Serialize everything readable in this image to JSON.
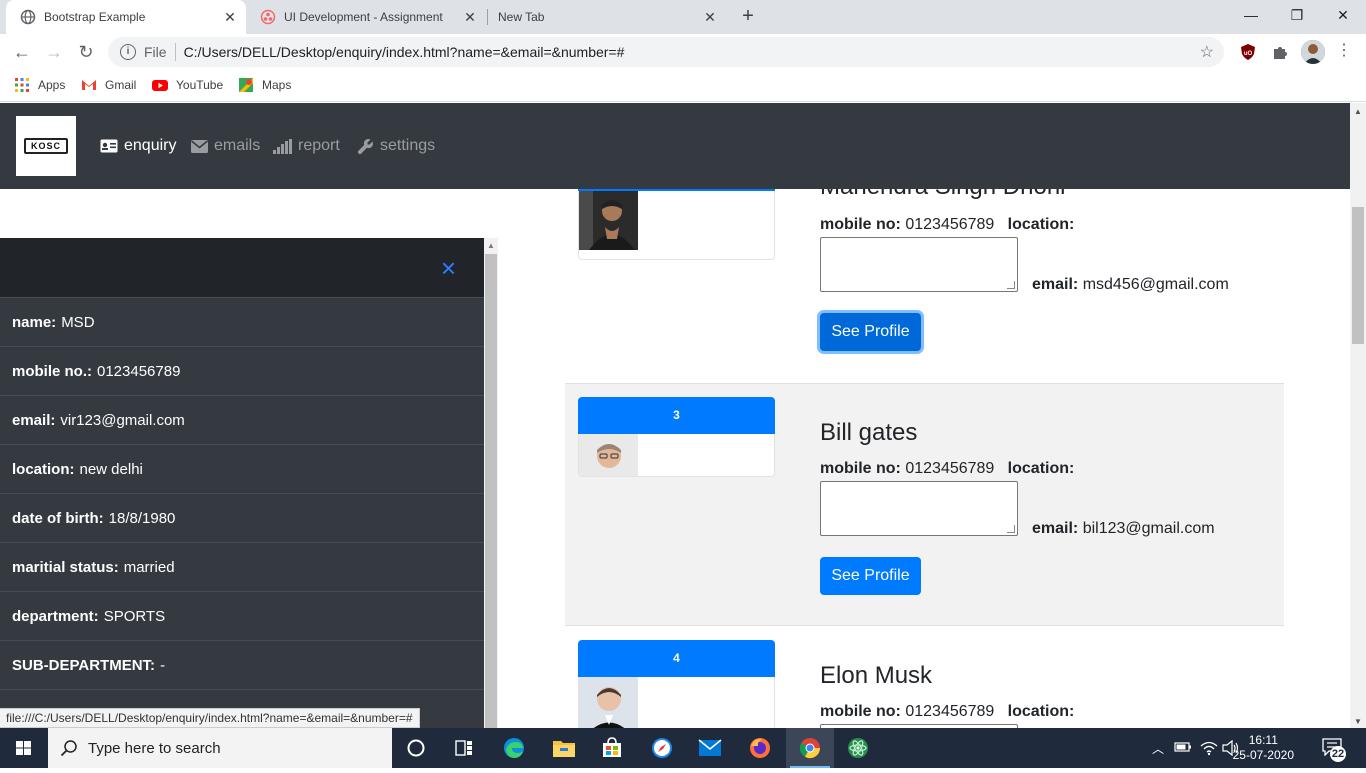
{
  "browser": {
    "tabs": [
      {
        "label": "Bootstrap Example",
        "icon": "globe-icon"
      },
      {
        "label": "UI Development - Assignment",
        "icon": "asana-icon"
      },
      {
        "label": "New Tab",
        "icon": ""
      }
    ],
    "url_prefix": "File",
    "url": "C:/Users/DELL/Desktop/enquiry/index.html?name=&email=&number=#",
    "bookmarks": [
      {
        "label": "Apps",
        "icon": "apps-grid-icon"
      },
      {
        "label": "Gmail",
        "icon": "gmail-icon"
      },
      {
        "label": "YouTube",
        "icon": "youtube-icon"
      },
      {
        "label": "Maps",
        "icon": "maps-icon"
      }
    ],
    "status_url": "file:///C:/Users/DELL/Desktop/enquiry/index.html?name=&email=&number=#"
  },
  "navbar": {
    "logo_text": "KOSC",
    "links": [
      {
        "label": "enquiry",
        "icon": "id-card-icon"
      },
      {
        "label": "emails",
        "icon": "envelope-icon"
      },
      {
        "label": "report",
        "icon": "signal-bars-icon"
      },
      {
        "label": "settings",
        "icon": "wrench-icon"
      }
    ]
  },
  "sidebar": {
    "close_symbol": "×",
    "rows": [
      {
        "label": "name:",
        "value": " MSD"
      },
      {
        "label": "mobile no.:",
        "value": "0123456789"
      },
      {
        "label": "email:",
        "value": "vir123@gmail.com"
      },
      {
        "label": "location:",
        "value": " new delhi"
      },
      {
        "label": "date of birth:",
        "value": "18/8/1980"
      },
      {
        "label": "maritial status:",
        "value": "married"
      },
      {
        "label": "department:",
        "value": "SPORTS"
      },
      {
        "label": "SUB-DEPARTMENT:",
        "value": "-"
      }
    ]
  },
  "cards": [
    {
      "number": "",
      "name": "Mahendra Singh Dhoni",
      "mobile_label": "mobile no:",
      "mobile": "0123456789",
      "location_label": "location:",
      "email_label": "email:",
      "email": "msd456@gmail.com",
      "button": "See Profile"
    },
    {
      "number": "3",
      "name": "Bill gates",
      "mobile_label": "mobile no:",
      "mobile": "0123456789",
      "location_label": "location:",
      "email_label": "email:",
      "email": "bil123@gmail.com",
      "button": "See Profile"
    },
    {
      "number": "4",
      "name": "Elon Musk",
      "mobile_label": "mobile no:",
      "mobile": "0123456789",
      "location_label": "location:"
    }
  ],
  "taskbar": {
    "search_placeholder": "Type here to search",
    "time": "16:11",
    "date": "25-07-2020",
    "notification_count": "22"
  },
  "colors": {
    "primary": "#007bff",
    "navbar": "#343a40",
    "sidebar": "#343a40"
  }
}
